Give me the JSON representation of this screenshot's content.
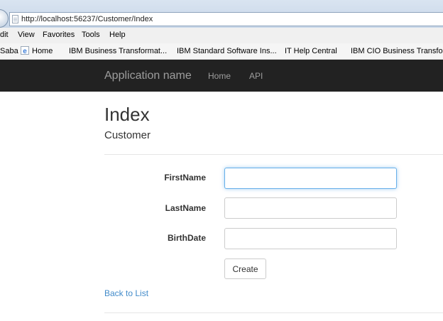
{
  "browser": {
    "url": "http://localhost:56237/Customer/Index",
    "menu": [
      "dit",
      "View",
      "Favorites",
      "Tools",
      "Help"
    ],
    "favorites": [
      "Saba",
      "Home",
      "IBM Business Transformat...",
      "IBM Standard Software Ins...",
      "IT Help Central",
      "IBM CIO Business Transfo..."
    ]
  },
  "navbar": {
    "brand": "Application name",
    "links": [
      "Home",
      "API"
    ]
  },
  "page": {
    "title": "Index",
    "subtitle": "Customer"
  },
  "form": {
    "fields": [
      {
        "label": "FirstName",
        "value": ""
      },
      {
        "label": "LastName",
        "value": ""
      },
      {
        "label": "BirthDate",
        "value": ""
      }
    ],
    "submit_label": "Create"
  },
  "back_link": "Back to List",
  "colors": {
    "navbar_bg": "#222222",
    "nav_text": "#9d9d9d",
    "link": "#428bca",
    "focus_border": "#66afe9"
  },
  "icons": {
    "page": "page-icon",
    "home": "ie-icon"
  }
}
